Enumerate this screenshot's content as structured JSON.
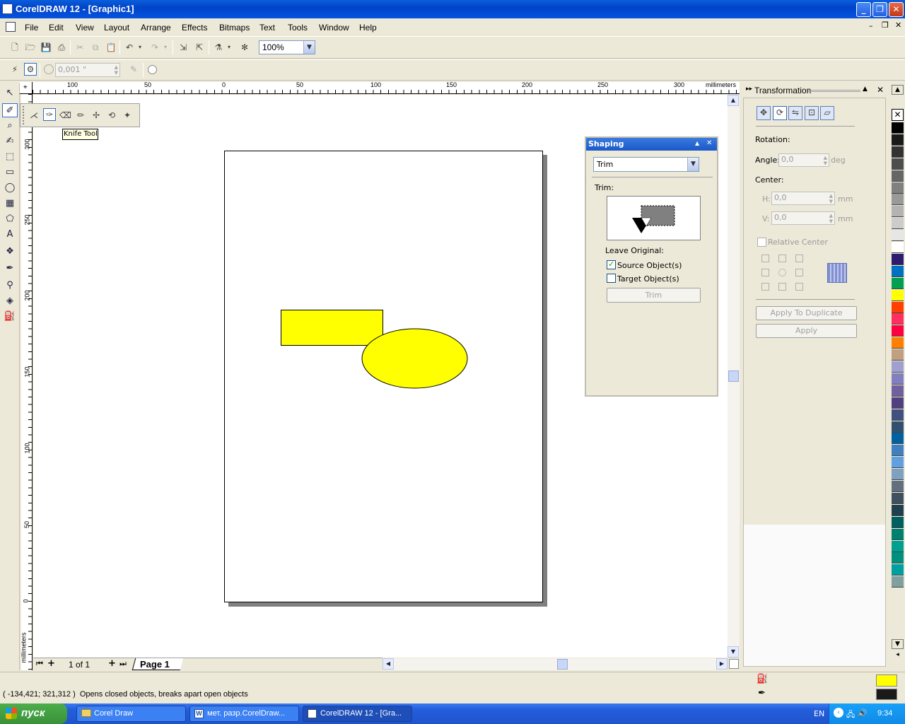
{
  "window": {
    "title": "CorelDRAW 12 - [Graphic1]"
  },
  "menu": [
    "File",
    "Edit",
    "View",
    "Layout",
    "Arrange",
    "Effects",
    "Bitmaps",
    "Text",
    "Tools",
    "Window",
    "Help"
  ],
  "toolbar": {
    "zoom": "100%",
    "nudge": "0,001 \""
  },
  "tooltip": "Knife Tool",
  "rulers": {
    "units": "millimeters",
    "h_labels": [
      "100",
      "50",
      "0",
      "50",
      "100",
      "150",
      "200",
      "250",
      "300"
    ],
    "v_labels": [
      "300",
      "250",
      "200",
      "150",
      "100",
      "50",
      "0"
    ]
  },
  "shapes": {
    "fill": "#ffff00"
  },
  "page_nav": {
    "counter": "1 of 1",
    "tab": "Page 1"
  },
  "shaping": {
    "title": "Shaping",
    "mode": "Trim",
    "section": "Trim:",
    "leave_original": "Leave Original:",
    "source": {
      "label": "Source Object(s)",
      "checked": true
    },
    "target": {
      "label": "Target Object(s)",
      "checked": false
    },
    "button": "Trim"
  },
  "transformation": {
    "title": "Transformation",
    "rotation": "Rotation:",
    "angle_label": "Angle:",
    "angle_value": "0,0",
    "angle_unit": "deg",
    "center": "Center:",
    "h_label": "H:",
    "h_value": "0,0",
    "v_label": "V:",
    "v_value": "0,0",
    "unit": "mm",
    "relative_center": "Relative Center",
    "apply_dup": "Apply To Duplicate",
    "apply": "Apply"
  },
  "palette": [
    "#000000",
    "#1a1a1a",
    "#333333",
    "#4d4d4d",
    "#666666",
    "#808080",
    "#999999",
    "#b3b3b3",
    "#cccccc",
    "#e6e6e6",
    "#ffffff",
    "#2e1a6e",
    "#0070c0",
    "#00a050",
    "#ffff00",
    "#ff4000",
    "#ff3060",
    "#ff0040",
    "#ff8000",
    "#c0a080",
    "#a0a0d0",
    "#8080c0",
    "#7060a0",
    "#504080",
    "#405080",
    "#305070",
    "#0060a0",
    "#4080c0",
    "#60a0e0",
    "#80a0c0",
    "#607080",
    "#405060",
    "#204050",
    "#006060",
    "#008070",
    "#00a090",
    "#009080",
    "#00a0a0",
    "#80a0a0"
  ],
  "status": {
    "text": "( -134,421; 321,312 )  Opens closed objects, breaks apart open objects",
    "fill_color": "#ffff00",
    "outline_color": "#1a1a1a"
  },
  "taskbar": {
    "start": "пуск",
    "tasks": [
      {
        "label": "Corel Draw"
      },
      {
        "label": "мет. разр.CorelDraw..."
      },
      {
        "label": "CorelDRAW 12 - [Gra..."
      }
    ],
    "lang": "EN",
    "time": "9:34"
  }
}
